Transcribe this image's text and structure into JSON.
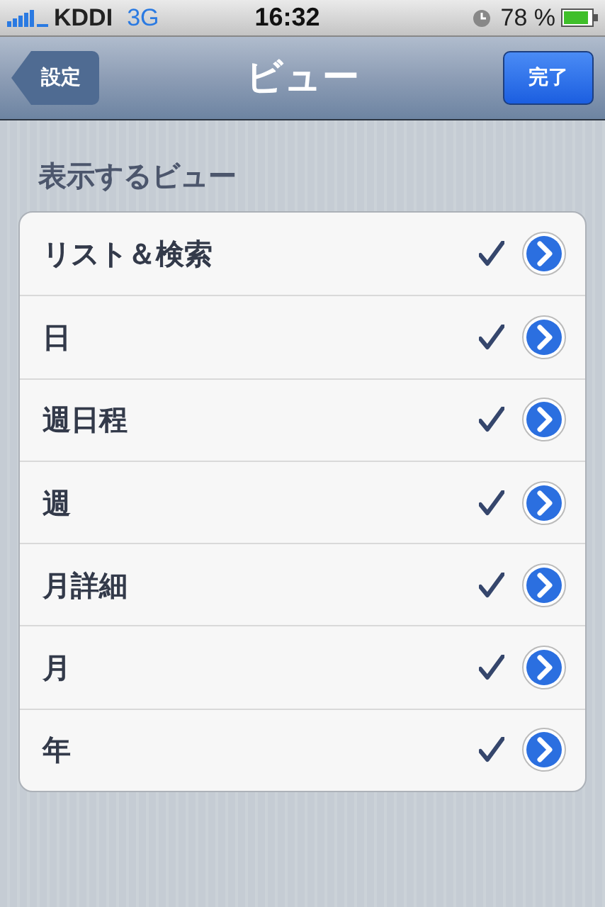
{
  "status_bar": {
    "carrier": "KDDI",
    "network": "3G",
    "time": "16:32",
    "battery": "78 %"
  },
  "nav_bar": {
    "back": "設定",
    "title": "ビュー",
    "done": "完了"
  },
  "section": {
    "header": "表示するビュー"
  },
  "rows": [
    {
      "label": "リスト＆検索",
      "checked": true
    },
    {
      "label": "日",
      "checked": true
    },
    {
      "label": "週日程",
      "checked": true
    },
    {
      "label": "週",
      "checked": true
    },
    {
      "label": "月詳細",
      "checked": true
    },
    {
      "label": "月",
      "checked": true
    },
    {
      "label": "年",
      "checked": true
    }
  ]
}
